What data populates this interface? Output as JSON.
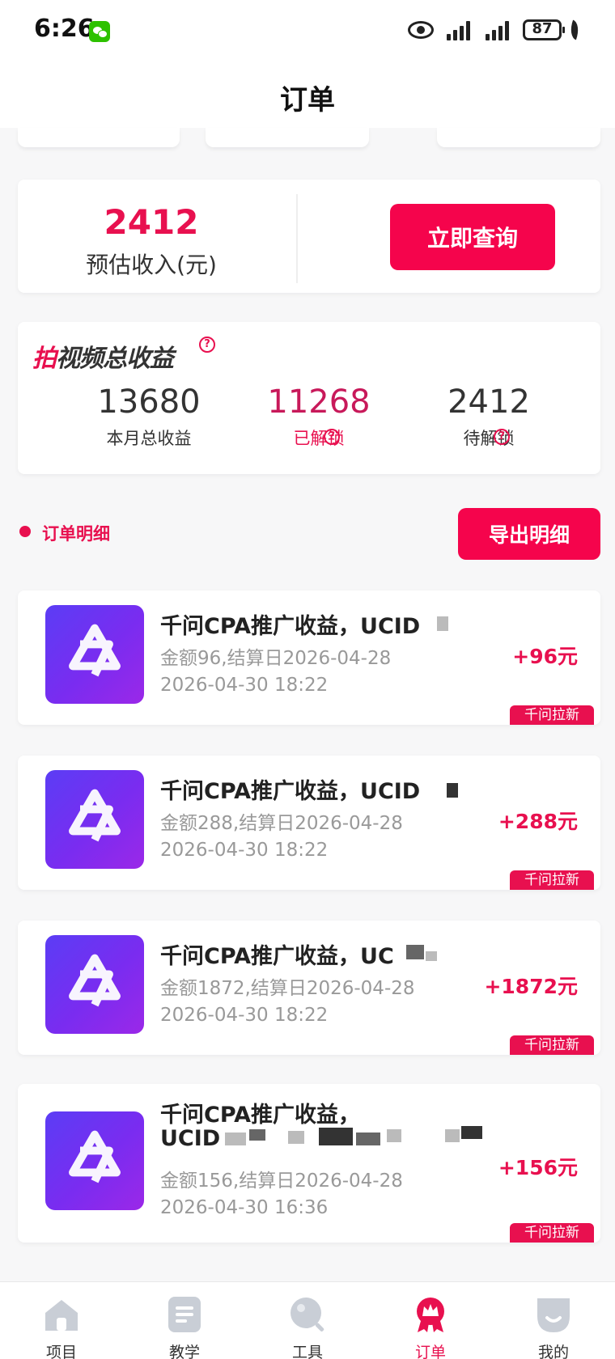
{
  "status_bar": {
    "time": "6:26",
    "battery": "87"
  },
  "header": {
    "title": "订单"
  },
  "income": {
    "amount": "2412",
    "label": "预估收入(元)",
    "query_button": "立即查询"
  },
  "video_earnings": {
    "title_accent": "拍",
    "title_rest": "视频总收益",
    "stats": [
      {
        "value": "13680",
        "label": "本月总收益"
      },
      {
        "value": "11268",
        "label": "已解锁"
      },
      {
        "value": "2412",
        "label": "待解锁"
      }
    ]
  },
  "orders_section": {
    "title": "订单明细",
    "export_button": "导出明细"
  },
  "orders": [
    {
      "title": "千问CPA推广收益，UCID",
      "detail": "金额96,结算日2026-04-28",
      "time": "2026-04-30 18:22",
      "amount": "+96元",
      "tag": "千问拉新"
    },
    {
      "title": "千问CPA推广收益，UCID",
      "detail": "金额288,结算日2026-04-28",
      "time": "2026-04-30 18:22",
      "amount": "+288元",
      "tag": "千问拉新"
    },
    {
      "title": "千问CPA推广收益，UC",
      "detail": "金额1872,结算日2026-04-28",
      "time": "2026-04-30 18:22",
      "amount": "+1872元",
      "tag": "千问拉新"
    },
    {
      "title": "千问CPA推广收益，",
      "title_line2": "UCID",
      "detail": "金额156,结算日2026-04-28",
      "time": "2026-04-30 16:36",
      "amount": "+156元",
      "tag": "千问拉新"
    }
  ],
  "bottom_nav": [
    {
      "label": "项目",
      "icon": "house-icon"
    },
    {
      "label": "教学",
      "icon": "document-icon"
    },
    {
      "label": "工具",
      "icon": "magnifier-icon"
    },
    {
      "label": "订单",
      "icon": "crown-badge-icon",
      "active": true
    },
    {
      "label": "我的",
      "icon": "profile-icon"
    }
  ],
  "colors": {
    "accent": "#e8104f",
    "button": "#f5044c",
    "logo_start": "#5b3df5",
    "logo_end": "#9b28e8"
  }
}
